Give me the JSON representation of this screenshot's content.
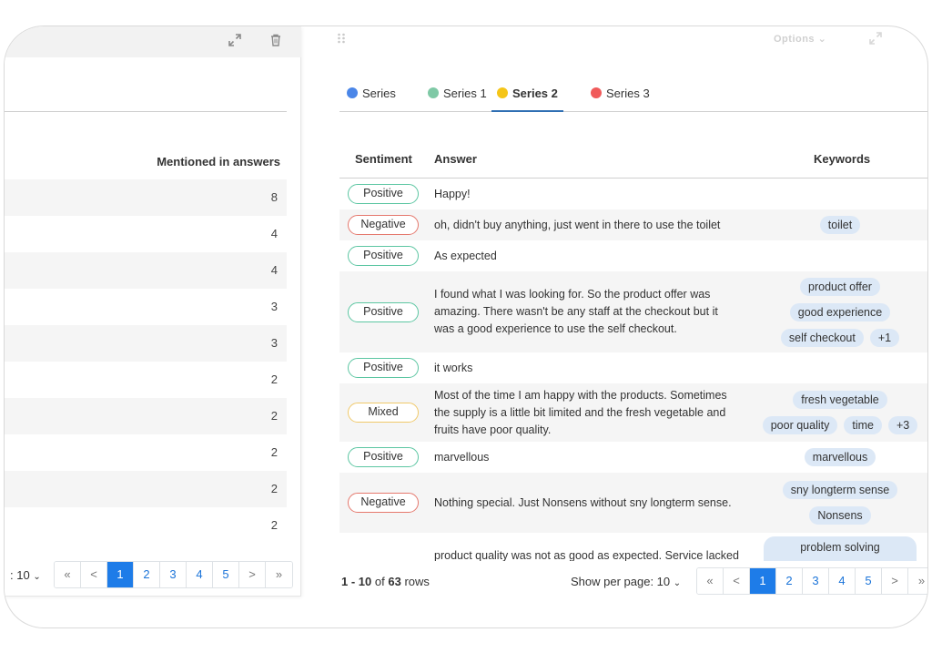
{
  "left": {
    "column_header": "Mentioned in answers",
    "rows": [
      "8",
      "4",
      "4",
      "3",
      "3",
      "2",
      "2",
      "2",
      "2",
      "2"
    ],
    "per_page_text": ": 10",
    "pagination": [
      "«",
      "<",
      "1",
      "2",
      "3",
      "4",
      "5",
      ">",
      "»"
    ],
    "active_page": "1"
  },
  "right": {
    "options_label": "Options",
    "tabs": [
      {
        "label": "Series",
        "color": "#4a86e8"
      },
      {
        "label": "Series 1",
        "color": "#7fc9a6"
      },
      {
        "label": "Series 2",
        "color": "#f5c518"
      },
      {
        "label": "Series 3",
        "color": "#f05a5a"
      }
    ],
    "active_tab": "Series 2",
    "columns": {
      "sentiment": "Sentiment",
      "answer": "Answer",
      "keywords": "Keywords"
    },
    "sentiment_colors": {
      "Positive": "#5cc6a2",
      "Negative": "#e5786d",
      "Mixed": "#f0c96a"
    },
    "rows": [
      {
        "sentiment": "Positive",
        "answer": [
          "Happy!"
        ],
        "keywords": []
      },
      {
        "sentiment": "Negative",
        "answer": [
          "oh, didn't buy anything, just went in there to use the toilet"
        ],
        "keywords": [
          [
            "toilet"
          ]
        ]
      },
      {
        "sentiment": "Positive",
        "answer": [
          "As expected"
        ],
        "keywords": []
      },
      {
        "sentiment": "Positive",
        "answer": [
          "I found what I was looking for. So the product offer was",
          "amazing. There wasn't be any staff at the checkout but it",
          "was a good experience to use the self checkout."
        ],
        "keywords": [
          [
            "product offer"
          ],
          [
            "good experience"
          ],
          [
            "self checkout",
            "+1"
          ]
        ]
      },
      {
        "sentiment": "Positive",
        "answer": [
          "it works"
        ],
        "keywords": []
      },
      {
        "sentiment": "Mixed",
        "answer": [
          "Most of the time I am happy with the products. Sometimes",
          "the supply is a little bit limited and the fresh vegetable and",
          "fruits have poor quality."
        ],
        "keywords": [
          [
            "fresh vegetable"
          ],
          [
            "poor quality",
            "time",
            "+3"
          ]
        ]
      },
      {
        "sentiment": "Positive",
        "answer": [
          "marvellous"
        ],
        "keywords": [
          [
            "marvellous"
          ]
        ]
      },
      {
        "sentiment": "Negative",
        "answer": [
          "Nothing special. Just Nonsens without sny longterm sense."
        ],
        "keywords": [
          [
            "sny longterm sense"
          ],
          [
            "Nonsens"
          ]
        ]
      },
      {
        "sentiment": "Negative",
        "answer": [
          "product quality was not as good as expected. Service lacked"
        ],
        "keywords": [
          [
            "problem solving"
          ]
        ]
      }
    ],
    "footer": {
      "range": "1 - 10",
      "of": "of",
      "total": "63",
      "rows_word": "rows",
      "per_page": "Show per page: 10"
    },
    "pagination": [
      "«",
      "<",
      "1",
      "2",
      "3",
      "4",
      "5",
      ">",
      "»"
    ],
    "active_page": "1"
  },
  "icons": {
    "expand": "expand-icon",
    "trash": "trash-icon",
    "drag": "drag-handle-icon",
    "chevron": "chevron-down-icon"
  }
}
